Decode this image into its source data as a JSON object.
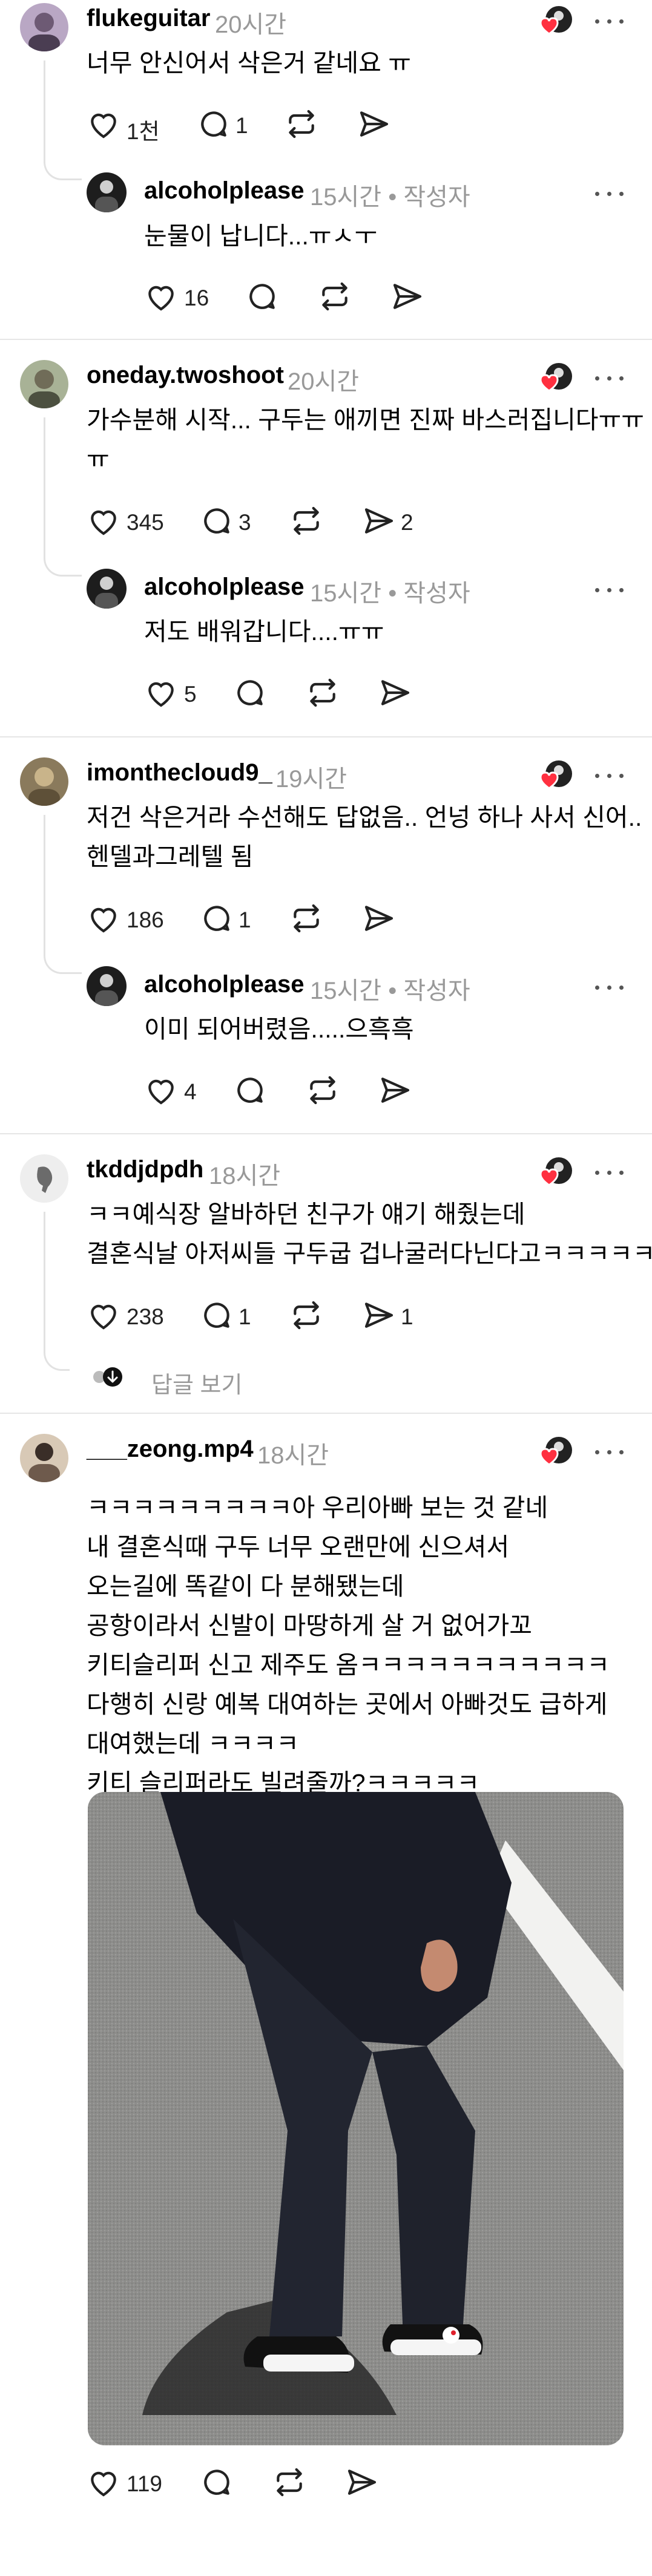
{
  "comments": [
    {
      "username": "flukeguitar",
      "time": "20시간",
      "lines": [
        "너무 안신어서 삭은거 같네요 ㅠ"
      ],
      "likes": "1천",
      "replies": "1",
      "shares": "",
      "reply": {
        "username": "alcoholplease",
        "meta": "15시간 • 작성자",
        "lines": [
          "눈물이 납니다...ㅠㅅㅜ"
        ],
        "likes": "16",
        "replies": "",
        "shares": ""
      }
    },
    {
      "username": "oneday.twoshoot",
      "time": "20시간",
      "lines": [
        "가수분해 시작... 구두는 애끼면 진짜 바스러집니다ㅠㅠ",
        "ㅠ"
      ],
      "likes": "345",
      "replies": "3",
      "shares": "2",
      "reply": {
        "username": "alcoholplease",
        "meta": "15시간 • 작성자",
        "lines": [
          "저도 배워갑니다....ㅠㅠ"
        ],
        "likes": "5",
        "replies": "",
        "shares": ""
      }
    },
    {
      "username": "imonthecloud9_",
      "time": "19시간",
      "lines": [
        "저건 삭은거라 수선해도 답없음.. 언넝 하나 사서 신어..",
        "헨델과그레텔 됨"
      ],
      "likes": "186",
      "replies": "1",
      "shares": "",
      "reply": {
        "username": "alcoholplease",
        "meta": "15시간 • 작성자",
        "lines": [
          "이미 되어버렸음.....으흑흑"
        ],
        "likes": "4",
        "replies": "",
        "shares": ""
      }
    },
    {
      "username": "tkddjdpdh",
      "time": "18시간",
      "lines": [
        "ㅋㅋ예식장 알바하던 친구가 얘기 해줬는데",
        "결혼식날 아저씨들 구두굽 겁나굴러다닌다고ㅋㅋㅋㅋㅋㅋ"
      ],
      "likes": "238",
      "replies": "1",
      "shares": "1",
      "view_replies": "답글 보기"
    },
    {
      "username": "___zeong.mp4",
      "time": "18시간",
      "lines": [
        "ㅋㅋㅋㅋㅋㅋㅋㅋㅋ아 우리아빠 보는 것 같네",
        "내 결혼식때 구두 너무 오랜만에 신으셔서",
        "오는길에 똑같이 다 분해됐는데",
        "공항이라서 신발이 마땅하게 살 거 없어가꼬",
        "키티슬리퍼 신고 제주도 옴ㅋㅋㅋㅋㅋㅋㅋㅋㅋㅋㅋ",
        "다행히 신랑 예복 대여하는 곳에서 아빠것도 급하게",
        "대여했는데 ㅋㅋㅋㅋ",
        "키티 슬리퍼라도 빌려줄까?ㅋㅋㅋㅋㅋ"
      ],
      "likes": "119",
      "replies": "",
      "shares": ""
    }
  ],
  "colors": {
    "heart_red": "#ff3040",
    "muted": "#999999",
    "divider": "#e6e6e6"
  }
}
